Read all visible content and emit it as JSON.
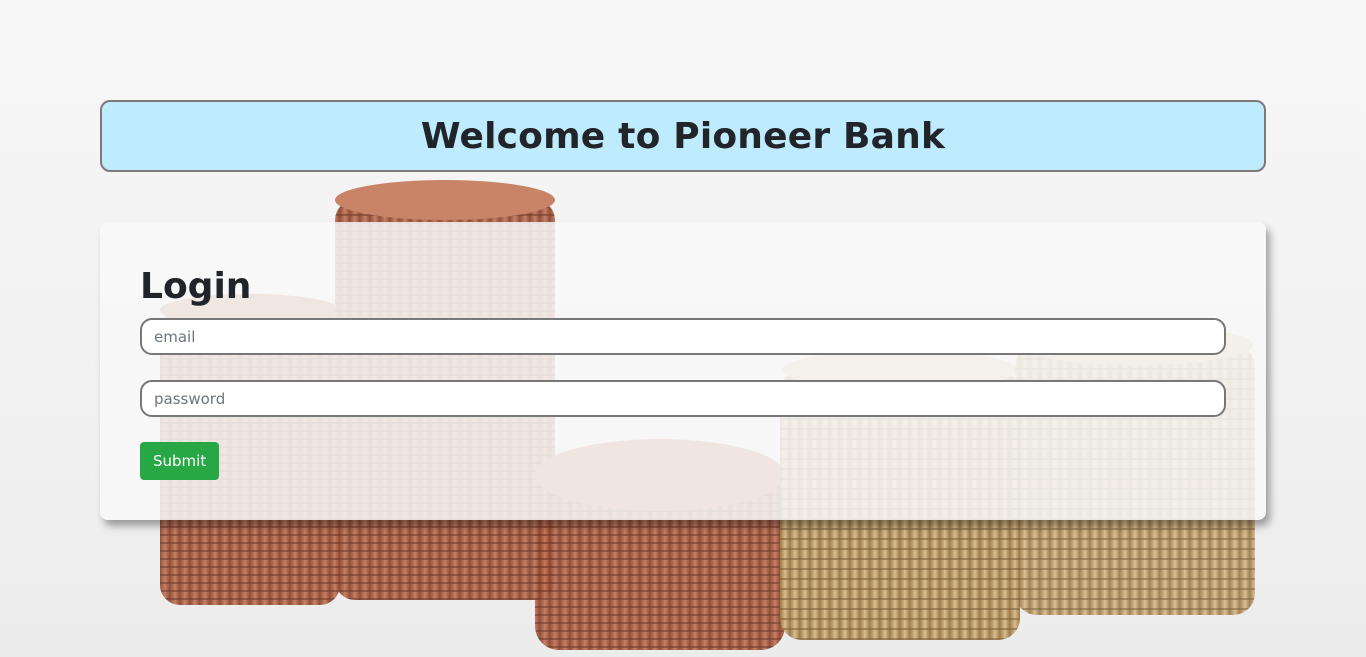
{
  "banner": {
    "title": "Welcome to Pioneer Bank"
  },
  "login": {
    "title": "Login",
    "email_placeholder": "email",
    "password_placeholder": "password",
    "submit_label": "Submit"
  },
  "colors": {
    "banner_bg": "#bfebfe",
    "submit_bg": "#28a745",
    "copper": "#b76b4f",
    "gold": "#c9a775"
  },
  "background": {
    "image": "coin-stacks-photo"
  }
}
